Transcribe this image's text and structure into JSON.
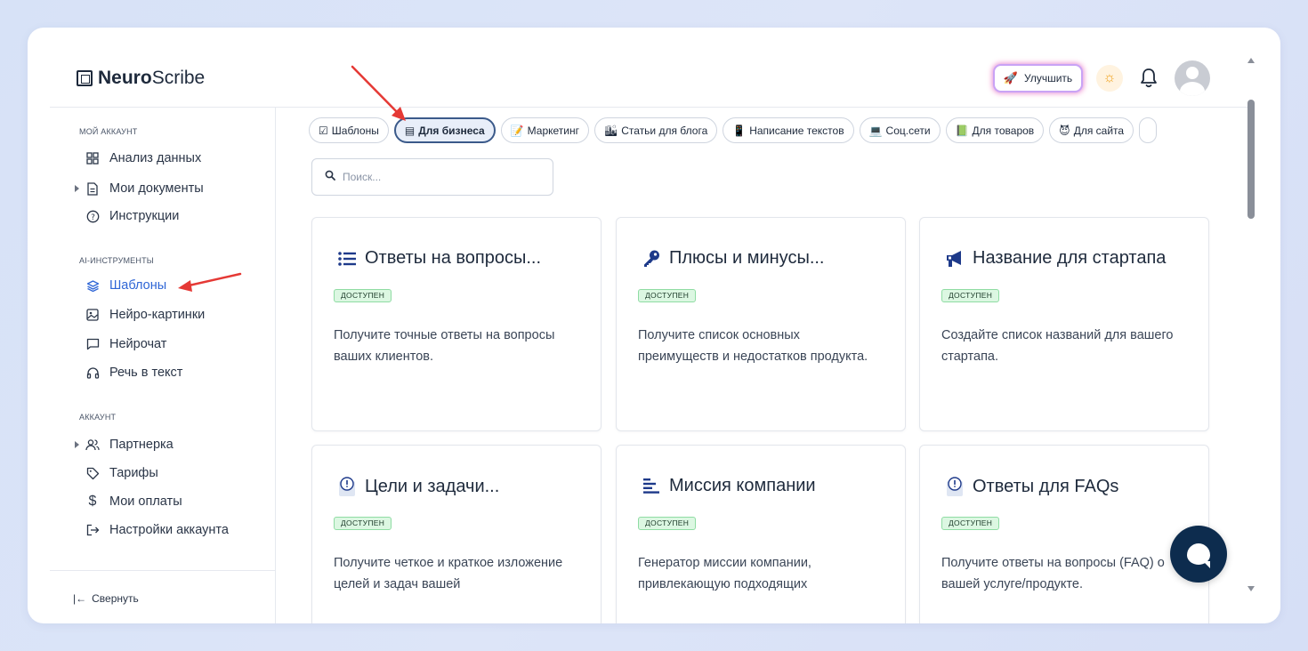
{
  "app": {
    "logo_bold": "Neuro",
    "logo_rest": "Scribe"
  },
  "header": {
    "upgrade_label": "Улучшить"
  },
  "sidebar": {
    "sections": [
      {
        "title": "МОЙ АККАУНТ"
      },
      {
        "title": "AI-ИНСТРУМЕНТЫ"
      },
      {
        "title": "АККАУНТ"
      }
    ],
    "items": [
      {
        "label": "Анализ данных",
        "icon": "grid-icon"
      },
      {
        "label": "Мои документы",
        "icon": "document-icon"
      },
      {
        "label": "Инструкции",
        "icon": "help-circle-icon"
      },
      {
        "label": "Шаблоны",
        "icon": "layers-icon"
      },
      {
        "label": "Нейро-картинки",
        "icon": "image-icon"
      },
      {
        "label": "Нейрочат",
        "icon": "chat-icon"
      },
      {
        "label": "Речь в текст",
        "icon": "headphones-icon"
      },
      {
        "label": "Партнерка",
        "icon": "users-icon"
      },
      {
        "label": "Тарифы",
        "icon": "tag-icon"
      },
      {
        "label": "Мои оплаты",
        "icon": "dollar-icon"
      },
      {
        "label": "Настройки аккаунта",
        "icon": "logout-icon"
      }
    ],
    "collapse_label": "Свернуть"
  },
  "categories": [
    {
      "label": "Шаблоны",
      "emoji": "☑"
    },
    {
      "label": "Для бизнеса",
      "emoji": "▤"
    },
    {
      "label": "Маркетинг",
      "emoji": "📝"
    },
    {
      "label": "Статьи для блога",
      "emoji": "🏙"
    },
    {
      "label": "Написание текстов",
      "emoji": "📱"
    },
    {
      "label": "Соц.сети",
      "emoji": "💻"
    },
    {
      "label": "Для товаров",
      "emoji": "📗"
    },
    {
      "label": "Для сайта",
      "emoji": "😈"
    }
  ],
  "search": {
    "placeholder": "Поиск..."
  },
  "cards": [
    {
      "title": "Ответы на вопросы...",
      "icon": "list-icon",
      "badge": "ДОСТУПЕН",
      "description": "Получите точные ответы на вопросы ваших клиентов."
    },
    {
      "title": "Плюсы и минусы...",
      "icon": "key-icon",
      "badge": "ДОСТУПЕН",
      "description": "Получите список основных преимуществ и недостатков продукта."
    },
    {
      "title": "Название для стартапа",
      "icon": "megaphone-icon",
      "badge": "ДОСТУПЕН",
      "description": "Создайте список названий для вашего стартапа."
    },
    {
      "title": "Цели и задачи...",
      "icon": "alert-icon",
      "badge": "ДОСТУПЕН",
      "description": "Получите четкое и краткое изложение целей и задач вашей"
    },
    {
      "title": "Миссия компании",
      "icon": "align-icon",
      "badge": "ДОСТУПЕН",
      "description": "Генератор миссии компании, привлекающую подходящих"
    },
    {
      "title": "Ответы для FAQs",
      "icon": "alert-icon",
      "badge": "ДОСТУПЕН",
      "description": "Получите ответы на вопросы (FAQ) о вашей услуге/продукте."
    }
  ],
  "colors": {
    "accent": "#2f66d6",
    "badge_bg": "#dcf7e2",
    "chat_button": "#0d2c4e",
    "annotation_arrow": "#e53935"
  }
}
